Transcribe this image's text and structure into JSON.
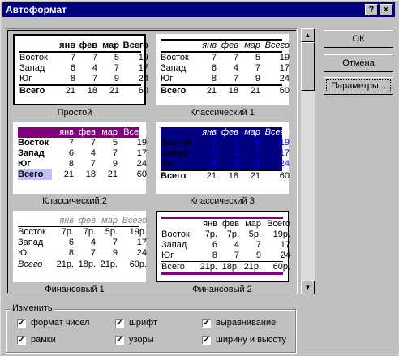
{
  "window": {
    "title": "Автоформат",
    "help_label": "?",
    "close_label": "×"
  },
  "buttons": {
    "ok": "ОК",
    "cancel": "Отмена",
    "options": "Параметры..."
  },
  "formats": [
    {
      "name": "Простой",
      "selected": true,
      "header": [
        "",
        "янв",
        "фев",
        "мар",
        "Всего"
      ],
      "rows": [
        [
          "Восток",
          "7",
          "7",
          "5",
          "19"
        ],
        [
          "Запад",
          "6",
          "4",
          "7",
          "17"
        ],
        [
          "Юг",
          "8",
          "7",
          "9",
          "24"
        ],
        [
          "Всего",
          "21",
          "18",
          "21",
          "60"
        ]
      ]
    },
    {
      "name": "Классический 1",
      "header": [
        "",
        "янв",
        "фев",
        "мар",
        "Всего"
      ],
      "rows": [
        [
          "Восток",
          "7",
          "7",
          "5",
          "19"
        ],
        [
          "Запад",
          "6",
          "4",
          "7",
          "17"
        ],
        [
          "Юг",
          "8",
          "7",
          "9",
          "24"
        ],
        [
          "Всего",
          "21",
          "18",
          "21",
          "60"
        ]
      ]
    },
    {
      "name": "Классический 2",
      "header": [
        "",
        "янв",
        "фев",
        "мар",
        "Всего"
      ],
      "rows": [
        [
          "Восток",
          "7",
          "7",
          "5",
          "19"
        ],
        [
          "Запад",
          "6",
          "4",
          "7",
          "17"
        ],
        [
          "Юг",
          "8",
          "7",
          "9",
          "24"
        ],
        [
          "Всего",
          "21",
          "18",
          "21",
          "60"
        ]
      ],
      "accent": "#800080"
    },
    {
      "name": "Классический 3",
      "header": [
        "",
        "янв",
        "фев",
        "мар",
        "Всего"
      ],
      "rows": [
        [
          "Восток",
          "7",
          "7",
          "5",
          "19"
        ],
        [
          "Запад",
          "6",
          "4",
          "7",
          "17"
        ],
        [
          "Юг",
          "8",
          "7",
          "9",
          "24"
        ],
        [
          "Всего",
          "21",
          "18",
          "21",
          "60"
        ]
      ],
      "accent": "#000080"
    },
    {
      "name": "Финансовый 1",
      "header": [
        "",
        "янв",
        "фев",
        "мар",
        "Всего"
      ],
      "rows": [
        [
          "Восток",
          "7р.",
          "7р.",
          "5р.",
          "19р."
        ],
        [
          "Запад",
          "6",
          "4",
          "7",
          "17"
        ],
        [
          "Юг",
          "8",
          "7",
          "9",
          "24"
        ],
        [
          "Всего",
          "21р.",
          "18р.",
          "21р.",
          "60р."
        ]
      ]
    },
    {
      "name": "Финансовый 2",
      "header": [
        "",
        "янв",
        "фев",
        "мар",
        "Всего"
      ],
      "rows": [
        [
          "Восток",
          "7р.",
          "7р.",
          "5р.",
          "19р."
        ],
        [
          "Запад",
          "6",
          "4",
          "7",
          "17"
        ],
        [
          "Юг",
          "8",
          "7",
          "9",
          "24"
        ],
        [
          "Всего",
          "21р.",
          "18р.",
          "21р.",
          "60р."
        ]
      ],
      "accent": "#800080"
    }
  ],
  "modify": {
    "label": "Изменить",
    "options": [
      {
        "label": "формат чисел",
        "checked": true
      },
      {
        "label": "шрифт",
        "checked": true
      },
      {
        "label": "выравнивание",
        "checked": true
      },
      {
        "label": "рамки",
        "checked": true
      },
      {
        "label": "узоры",
        "checked": true
      },
      {
        "label": "ширину и высоту",
        "checked": true
      }
    ]
  }
}
